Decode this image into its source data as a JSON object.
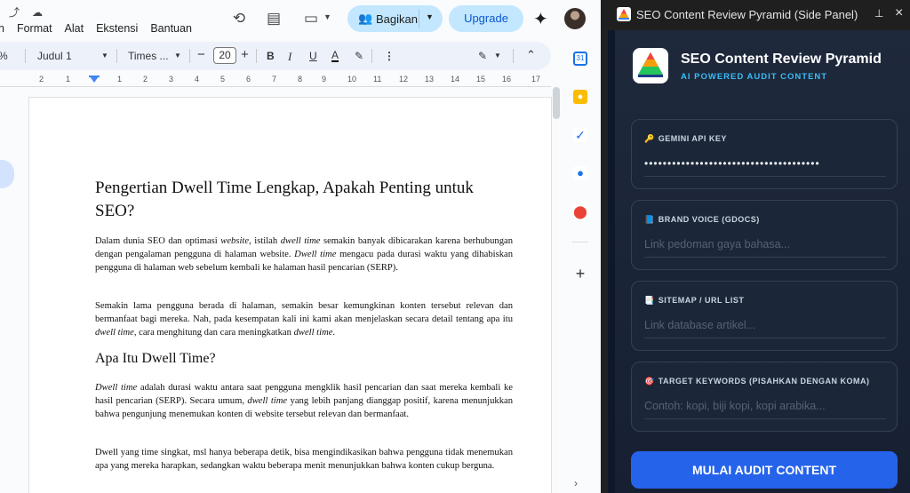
{
  "menu": [
    "n",
    "Format",
    "Alat",
    "Ekstensi",
    "Bantuan"
  ],
  "header": {
    "share_label": "Bagikan",
    "upgrade_label": "Upgrade"
  },
  "toolbar": {
    "percent": "%",
    "style": "Judul 1",
    "font": "Times ...",
    "font_size": "20",
    "bold": "B",
    "italic": "I",
    "underline": "U",
    "color": "A"
  },
  "ruler": [
    "2",
    "1",
    "1",
    "2",
    "3",
    "4",
    "5",
    "6",
    "7",
    "8",
    "9",
    "10",
    "11",
    "12",
    "13",
    "14",
    "15",
    "16",
    "17"
  ],
  "doc": {
    "title": "Pengertian Dwell Time Lengkap, Apakah Penting untuk SEO?",
    "p1_a": "Dalam dunia SEO dan optimasi ",
    "p1_b": "website",
    "p1_c": ", istilah ",
    "p1_d": "dwell time",
    "p1_e": " semakin banyak dibicarakan karena berhubungan dengan pengalaman pengguna di halaman website. ",
    "p1_f": "Dwell time",
    "p1_g": " mengacu pada durasi waktu yang dihabiskan pengguna di halaman web sebelum kembali ke halaman hasil pencarian (SERP).",
    "p2_a": "Semakin lama pengguna berada di halaman, semakin besar kemungkinan konten tersebut relevan dan bermanfaat bagi mereka. Nah, pada kesempatan kali ini kami akan menjelaskan secara detail tentang apa itu ",
    "p2_b": "dwell time",
    "p2_c": ", cara menghitung dan cara meningkatkan ",
    "p2_d": "dwell time",
    "p2_e": ".",
    "h2": "Apa Itu Dwell Time?",
    "p3_a": "Dwell time",
    "p3_b": " adalah durasi waktu antara saat pengguna mengklik hasil pencarian dan saat mereka kembali ke hasil pencarian (SERP). Secara umum, ",
    "p3_c": "dwell time",
    "p3_d": " yang lebih panjang dianggap positif, karena menunjukkan bahwa pengunjung menemukan konten di website tersebut relevan dan bermanfaat.",
    "p4": "Dwell yang time singkat, msl hanya beberapa detik, bisa mengindikasikan bahwa pengguna tidak menemukan apa yang mereka harapkan, sedangkan waktu beberapa menit menunjukkan bahwa konten cukup berguna."
  },
  "side_panel": {
    "window_title": "SEO Content Review Pyramid (Side Panel)",
    "brand_title": "SEO Content Review Pyramid",
    "brand_subtitle": "AI POWERED AUDIT CONTENT",
    "fields": [
      {
        "emoji": "🔑",
        "label": "GEMINI API KEY",
        "value": "••••••••••••••••••••••••••••••••••••••"
      },
      {
        "emoji": "📘",
        "label": "BRAND VOICE (GDOCS)",
        "placeholder": "Link pedoman gaya bahasa..."
      },
      {
        "emoji": "📑",
        "label": "SITEMAP / URL LIST",
        "placeholder": "Link database artikel..."
      },
      {
        "emoji": "🎯",
        "label": "TARGET KEYWORDS (PISAHKAN DENGAN KOMA)",
        "placeholder": "Contoh: kopi, biji kopi, kopi arabika..."
      }
    ],
    "audit_button": "MULAI AUDIT CONTENT"
  }
}
